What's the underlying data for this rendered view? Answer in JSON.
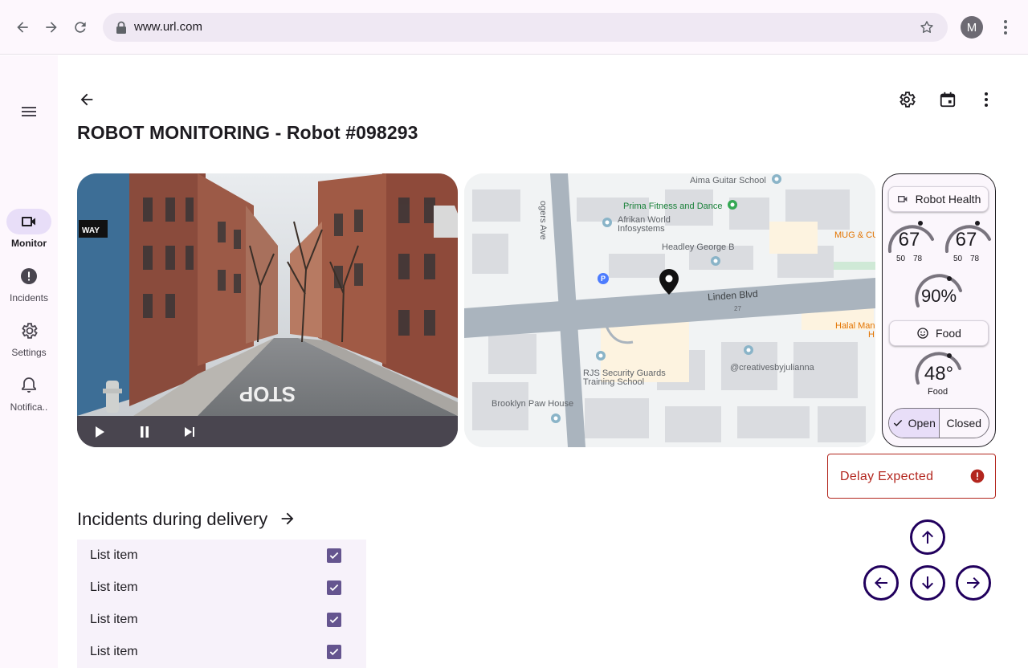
{
  "browser": {
    "url": "www.url.com",
    "avatar_letter": "M"
  },
  "rail": {
    "items": [
      {
        "label": "Monitor",
        "icon": "videocam-icon",
        "active": true
      },
      {
        "label": "Incidents",
        "icon": "alert-circle-icon",
        "active": false
      },
      {
        "label": "Settings",
        "icon": "gear-icon",
        "active": false
      },
      {
        "label": "Notifica..",
        "icon": "bell-icon",
        "active": false
      }
    ]
  },
  "page": {
    "title": "ROBOT MONITORING - Robot #098293"
  },
  "video": {
    "progress": 0.81
  },
  "map": {
    "labels": [
      "Aima Guitar School",
      "Prima Fitness and Dance",
      "Afrikan World",
      "Infosystems",
      "Headley George B",
      "MUG & CU",
      "Linden Blvd",
      "27",
      "Halal Man",
      "H",
      "RJS Security Guards",
      "Training School",
      "@creativesbyjulianna",
      "Brooklyn Paw House",
      "ogers Ave",
      "P"
    ]
  },
  "health": {
    "header_chip": "Robot Health",
    "gauge1": {
      "value": "67",
      "min": "50",
      "max": "78"
    },
    "gauge2": {
      "value": "67",
      "min": "50",
      "max": "78"
    },
    "gauge3": {
      "value": "90%"
    },
    "food_chip": "Food",
    "gauge4": {
      "value": "48°",
      "label": "Food"
    },
    "segmented": {
      "open": "Open",
      "closed": "Closed",
      "selected": "Open"
    }
  },
  "alert": {
    "text": "Delay Expected",
    "color": "#b3261e"
  },
  "incidents": {
    "title": "Incidents during delivery",
    "items": [
      "List item",
      "List item",
      "List item",
      "List item"
    ]
  },
  "colors": {
    "accent": "#65558f",
    "rail_active": "#e8def8",
    "dpad": "#21005d"
  }
}
